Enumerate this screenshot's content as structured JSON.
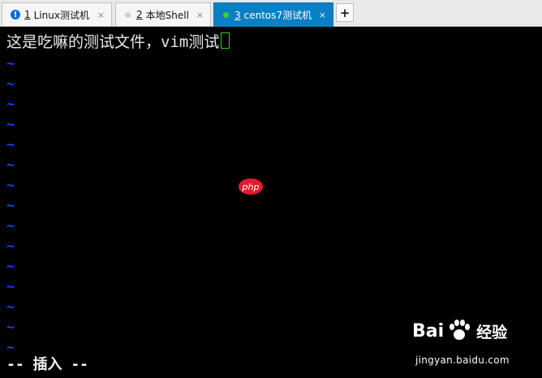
{
  "tabs": [
    {
      "num": "1",
      "label": "Linux测试机",
      "icon": "info-icon",
      "close": "×"
    },
    {
      "num": "2",
      "label": "本地Shell",
      "icon": "status-dot-gray",
      "close": "×"
    },
    {
      "num": "3",
      "label": "centos7测试机",
      "icon": "status-dot-green",
      "close": "×",
      "active": true
    }
  ],
  "add_tab": "+",
  "terminal": {
    "line1": "这是吃嘛的测试文件，vim测试",
    "tilde": "~",
    "status": "-- 插入 --"
  },
  "watermark": {
    "php": "php",
    "brand_left": "Bai",
    "brand_cn": "经验",
    "url": "jingyan.baidu.com"
  },
  "colors": {
    "active_tab": "#0a7fc4",
    "tilde": "#1d3cf5",
    "cursor": "#29d129"
  }
}
